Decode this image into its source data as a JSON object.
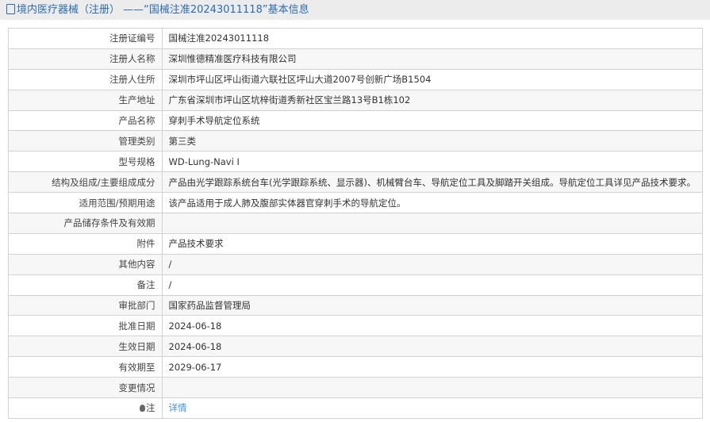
{
  "header": {
    "title": "境内医疗器械（注册） ——“国械注准20243011118”基本信息",
    "icon": "document-icon",
    "color": "#2b6cb5"
  },
  "rows": [
    {
      "label": "注册证编号",
      "value": "国械注准20243011118"
    },
    {
      "label": "注册人名称",
      "value": "深圳惟德精准医疗科技有限公司"
    },
    {
      "label": "注册人住所",
      "value": "深圳市坪山区坪山街道六联社区坪山大道2007号创新广场B1504"
    },
    {
      "label": "生产地址",
      "value": "广东省深圳市坪山区坑梓街道秀新社区宝兰路13号B1栋102"
    },
    {
      "label": "产品名称",
      "value": "穿刺手术导航定位系统"
    },
    {
      "label": "管理类别",
      "value": "第三类"
    },
    {
      "label": "型号规格",
      "value": "WD-Lung-Navi I"
    },
    {
      "label": "结构及组成/主要组成成分",
      "value": "产品由光学跟踪系统台车(光学跟踪系统、显示器)、机械臂台车、导航定位工具及脚踏开关组成。导航定位工具详见产品技术要求。"
    },
    {
      "label": "适用范围/预期用途",
      "value": "该产品适用于成人肺及腹部实体器官穿刺手术的导航定位。"
    },
    {
      "label": "产品储存条件及有效期",
      "value": ""
    },
    {
      "label": "附件",
      "value": "产品技术要求"
    },
    {
      "label": "其他内容",
      "value": "/"
    },
    {
      "label": "备注",
      "value": "/"
    },
    {
      "label": "审批部门",
      "value": "国家药品监督管理局"
    },
    {
      "label": "批准日期",
      "value": "2024-06-18"
    },
    {
      "label": "生效日期",
      "value": "2024-06-18"
    },
    {
      "label": "有效期至",
      "value": "2029-06-17"
    },
    {
      "label": "变更情况",
      "value": ""
    }
  ],
  "note": {
    "label": "注",
    "icon": "lightbulb-icon",
    "link": "详情",
    "link_color": "#3a8ee6"
  }
}
